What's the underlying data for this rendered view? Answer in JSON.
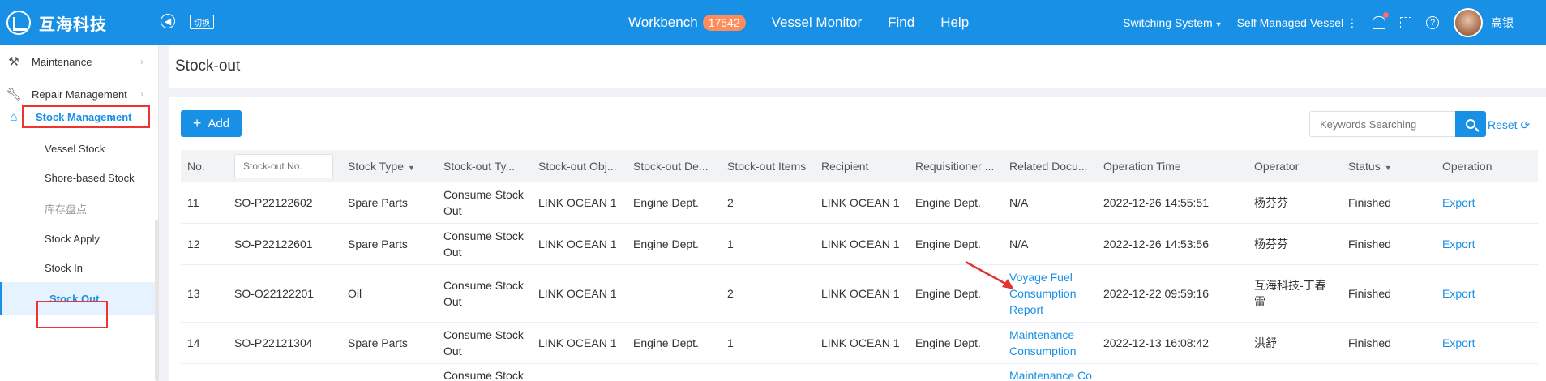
{
  "topbar": {
    "logo_text": "互海科技",
    "switch_label": "切换",
    "nav": [
      {
        "label": "Workbench",
        "badge": "17542"
      },
      {
        "label": "Vessel Monitor"
      },
      {
        "label": "Find"
      },
      {
        "label": "Help"
      }
    ],
    "switching_system": "Switching System",
    "vessel_type": "Self Managed Vessel",
    "username": "高银",
    "help_glyph": "?"
  },
  "sidebar": {
    "maintenance": "Maintenance",
    "repair": "Repair Management",
    "stock": "Stock Management",
    "sub_items": [
      "Vessel Stock",
      "Shore-based Stock",
      "库存盘点",
      "Stock Apply",
      "Stock In",
      "Stock Out"
    ]
  },
  "page": {
    "title": "Stock-out",
    "add_label": "Add",
    "search_placeholder": "Keywords Searching",
    "reset_label": "Reset"
  },
  "table": {
    "headers": [
      "No.",
      "",
      "Stock Type",
      "Stock-out Ty...",
      "Stock-out Obj...",
      "Stock-out De...",
      "Stock-out Items",
      "Recipient",
      "Requisitioner ...",
      "Related Docu...",
      "Operation Time",
      "Operator",
      "Status",
      "Operation"
    ],
    "filter_placeholder": "Stock-out No.",
    "rows": [
      [
        "11",
        "SO-P22122602",
        "Spare Parts",
        "Consume Stock Out",
        "LINK OCEAN 1",
        "Engine Dept.",
        "2",
        "LINK OCEAN 1",
        "Engine Dept.",
        "N/A",
        "2022-12-26 14:55:51",
        "杨芬芬",
        "Finished",
        "Export"
      ],
      [
        "12",
        "SO-P22122601",
        "Spare Parts",
        "Consume Stock Out",
        "LINK OCEAN 1",
        "Engine Dept.",
        "1",
        "LINK OCEAN 1",
        "Engine Dept.",
        "N/A",
        "2022-12-26 14:53:56",
        "杨芬芬",
        "Finished",
        "Export"
      ],
      [
        "13",
        "SO-O22122201",
        "Oil",
        "Consume Stock Out",
        "LINK OCEAN 1",
        "",
        "2",
        "LINK OCEAN 1",
        "Engine Dept.",
        "Voyage Fuel Consumption Report",
        "2022-12-22 09:59:16",
        "互海科技-丁春雷",
        "Finished",
        "Export"
      ],
      [
        "14",
        "SO-P22121304",
        "Spare Parts",
        "Consume Stock Out",
        "LINK OCEAN 1",
        "Engine Dept.",
        "1",
        "LINK OCEAN 1",
        "Engine Dept.",
        "Maintenance Consumption",
        "2022-12-13 16:08:42",
        "洪舒",
        "Finished",
        "Export"
      ],
      [
        "",
        "",
        "",
        "Consume Stock",
        "",
        "",
        "",
        "",
        "",
        "Maintenance Co",
        "",
        "",
        "",
        ""
      ]
    ]
  },
  "colors": {
    "primary": "#1890e6",
    "annotation": "#e33333",
    "badge": "#ff8c5a"
  }
}
